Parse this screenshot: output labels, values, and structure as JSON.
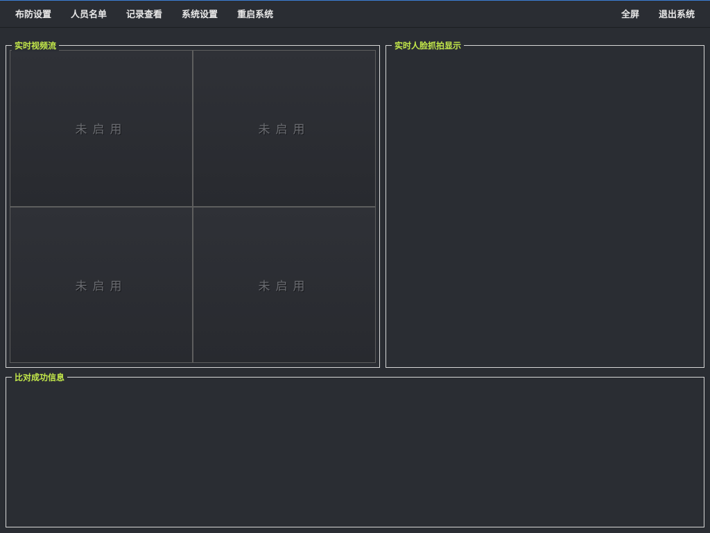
{
  "menu": {
    "left": [
      {
        "label": "布防设置"
      },
      {
        "label": "人员名单"
      },
      {
        "label": "记录查看"
      },
      {
        "label": "系统设置"
      },
      {
        "label": "重启系统"
      }
    ],
    "right": [
      {
        "label": "全屏"
      },
      {
        "label": "退出系统"
      }
    ]
  },
  "panels": {
    "video": {
      "title": "实时视频流"
    },
    "face": {
      "title": "实时人脸抓拍显示"
    },
    "match": {
      "title": "比对成功信息"
    }
  },
  "video_cells": [
    {
      "status": "未启用"
    },
    {
      "status": "未启用"
    },
    {
      "status": "未启用"
    },
    {
      "status": "未启用"
    }
  ]
}
